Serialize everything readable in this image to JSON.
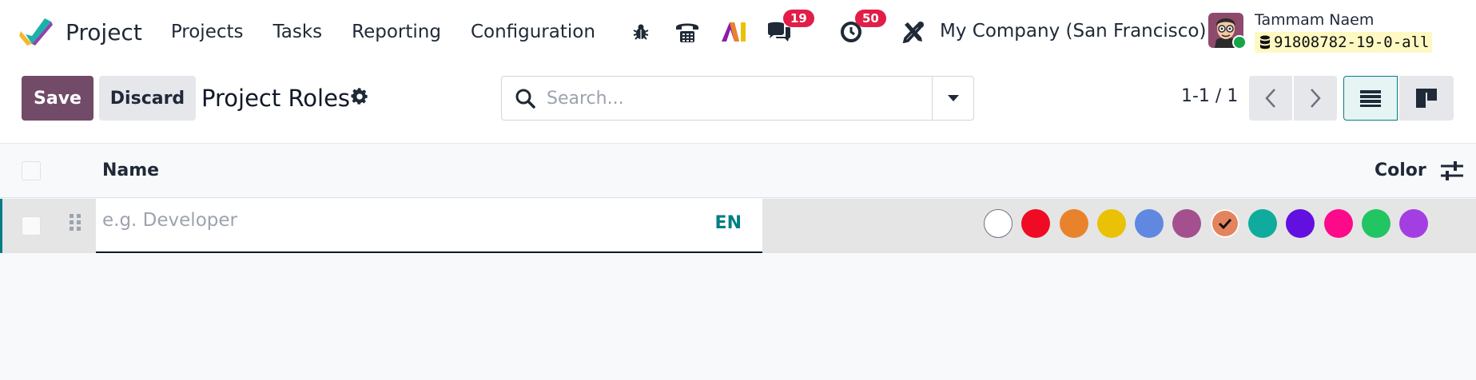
{
  "app": {
    "name": "Project"
  },
  "menu": [
    {
      "label": "Projects"
    },
    {
      "label": "Tasks"
    },
    {
      "label": "Reporting"
    },
    {
      "label": "Configuration"
    }
  ],
  "systray": {
    "messages_count": "19",
    "activities_count": "50",
    "company": "My Company (San Francisco)",
    "user_name": "Tammam Naem",
    "database": "91808782-19-0-all"
  },
  "control": {
    "save_label": "Save",
    "discard_label": "Discard",
    "title": "Project Roles",
    "search_placeholder": "Search...",
    "pager": "1-1 / 1"
  },
  "table": {
    "columns": {
      "name": "Name",
      "color": "Color"
    },
    "row": {
      "name_placeholder": "e.g. Developer",
      "lang": "EN",
      "selected_color_index": 6
    }
  },
  "colors": {
    "accent": "#714b67",
    "teal": "#017e84",
    "swatches": [
      "#ffffff",
      "#f00b25",
      "#e8832b",
      "#e9c207",
      "#6088e0",
      "#a4508e",
      "#e3845e",
      "#0fab9c",
      "#6210e0",
      "#fd0a8a",
      "#21c562",
      "#a33ee3"
    ]
  }
}
